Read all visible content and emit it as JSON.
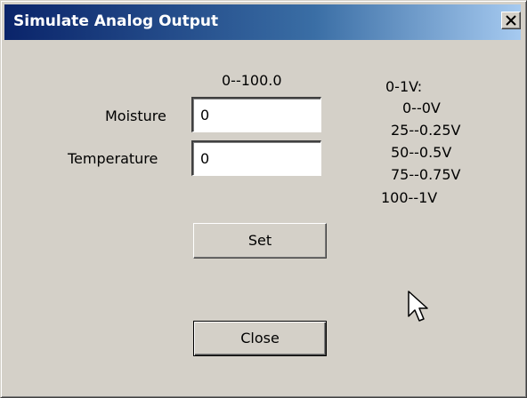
{
  "window": {
    "title": "Simulate Analog Output",
    "close_glyph": "✕"
  },
  "form": {
    "range_label": "0--100.0",
    "moisture_label": "Moisture",
    "moisture_value": "0",
    "temperature_label": "Temperature",
    "temperature_value": "0"
  },
  "legend": {
    "heading": "0-1V:",
    "lines": [
      "0--0V",
      "25--0.25V",
      "50--0.5V",
      "75--0.75V",
      "100--1V"
    ]
  },
  "buttons": {
    "set_label": "Set",
    "close_label": "Close"
  },
  "colors": {
    "face": "#d4d0c8",
    "title_start": "#0a246a",
    "title_end": "#a6caf0"
  },
  "icons": {
    "close": "close-icon",
    "cursor": "mouse-pointer-icon"
  }
}
